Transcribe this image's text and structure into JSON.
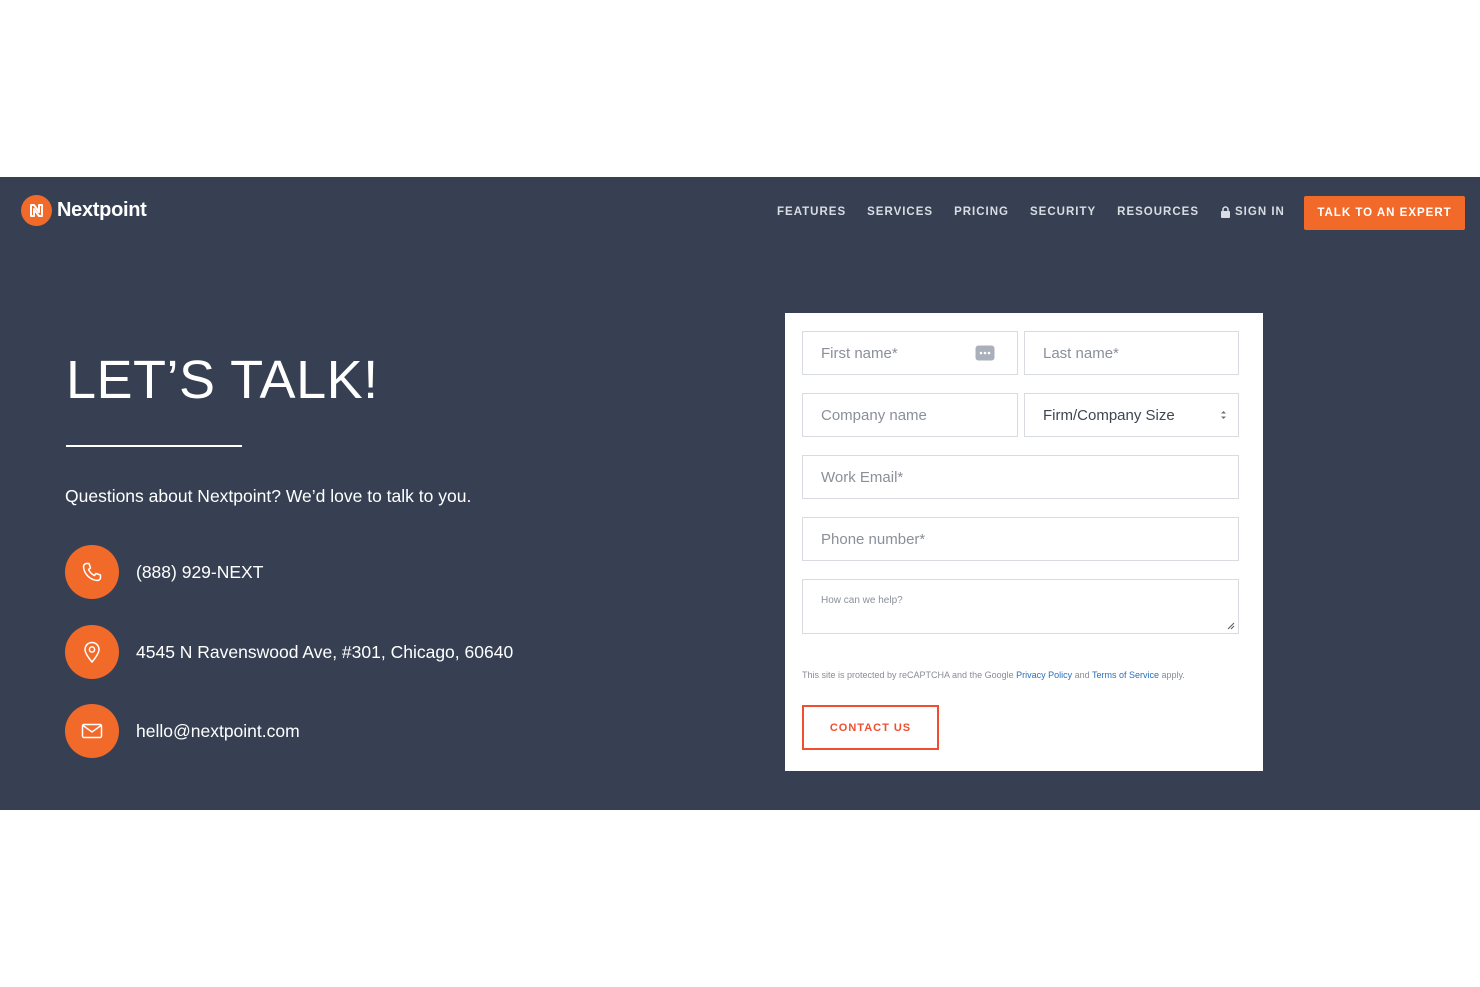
{
  "brand": {
    "name": "Nextpoint",
    "accent": "#f26a2a",
    "band_bg": "#364052"
  },
  "nav": {
    "items": [
      {
        "label": "FEATURES"
      },
      {
        "label": "SERVICES"
      },
      {
        "label": "PRICING"
      },
      {
        "label": "SECURITY"
      },
      {
        "label": "RESOURCES"
      }
    ],
    "sign_in": "SIGN IN",
    "cta": "TALK TO AN EXPERT"
  },
  "hero": {
    "title": "LET’S TALK!",
    "subtitle": "Questions about Nextpoint? We’d love to talk to you."
  },
  "contacts": {
    "phone": {
      "icon": "phone-icon",
      "text": "(888) 929-NEXT"
    },
    "address": {
      "icon": "map-pin-icon",
      "text": "4545 N Ravenswood Ave, #301, Chicago, 60640"
    },
    "email": {
      "icon": "mail-icon",
      "text": "hello@nextpoint.com"
    }
  },
  "form": {
    "first_name_placeholder": "First name*",
    "last_name_placeholder": "Last name*",
    "company_placeholder": "Company name",
    "size_selected": "Firm/Company Size",
    "email_placeholder": "Work Email*",
    "phone_placeholder": "Phone number*",
    "message_placeholder": "How can we help?",
    "captcha": {
      "prefix": "This site is protected by reCAPTCHA and the Google ",
      "privacy": "Privacy Policy",
      "and": " and ",
      "terms": "Terms of Service",
      "suffix": " apply."
    },
    "submit_label": "CONTACT US"
  }
}
